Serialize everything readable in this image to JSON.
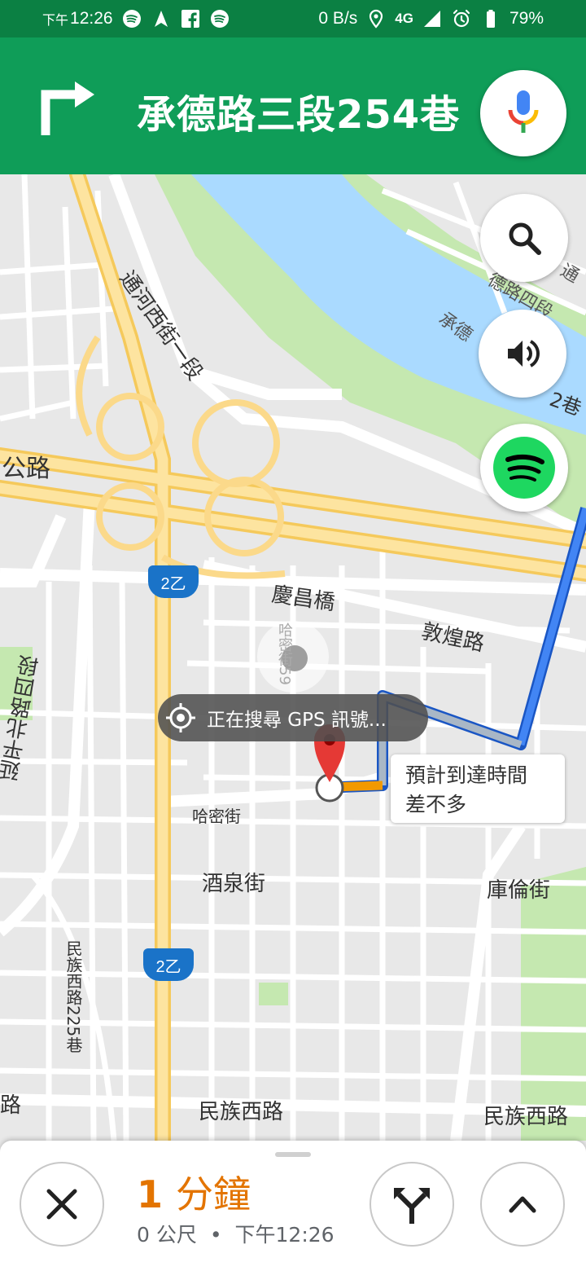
{
  "status_bar": {
    "time_prefix": "下午",
    "time": "12:26",
    "net_speed": "0 B/s",
    "network": "4G",
    "battery": "79%"
  },
  "navigation": {
    "street": "承德路三段254巷"
  },
  "map": {
    "labels": {
      "road_tonghe": "通河西街一段",
      "road_highway": "公路",
      "road_qingchang": "慶昌橋",
      "road_dunhuang": "敦煌路",
      "road_yanping": "延平北路四段",
      "road_hami": "哈密街",
      "road_jiuquan": "酒泉街",
      "road_kulun": "庫倫街",
      "road_minzu_225": "民族西路225巷",
      "road_minzu_left": "民族西路",
      "road_minzu_right": "民族西路",
      "road_minzu_edge": "路",
      "road_chengde_right1": "通",
      "road_chengde_right2": "德路四段",
      "road_chengde_right3": "承德",
      "road_alley_right": "2巷",
      "faded_street": "哈密街59"
    },
    "route_shields": [
      "2乙",
      "2乙"
    ],
    "gps_status": "正在搜尋 GPS 訊號...",
    "eta_callout_line1": "預計到達時間",
    "eta_callout_line2": "差不多"
  },
  "sheet": {
    "eta_number": "1",
    "eta_unit": "分鐘",
    "distance": "0 公尺",
    "separator": "•",
    "arrival_time": "下午12:26"
  },
  "colors": {
    "status_bar": "#0b8043",
    "header": "#0f9d58",
    "route": "#4285f4",
    "eta": "#e37400",
    "water": "#aadaff",
    "park": "#c5e8b0",
    "highway": "#fcd97a"
  }
}
